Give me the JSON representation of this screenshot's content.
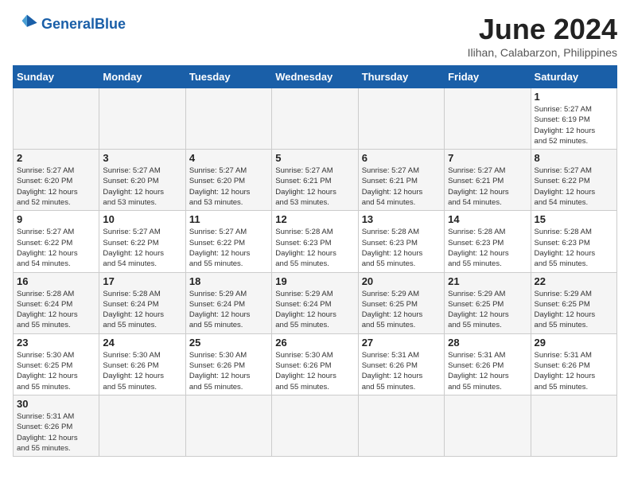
{
  "header": {
    "logo_general": "General",
    "logo_blue": "Blue",
    "month_title": "June 2024",
    "subtitle": "Ilihan, Calabarzon, Philippines"
  },
  "weekdays": [
    "Sunday",
    "Monday",
    "Tuesday",
    "Wednesday",
    "Thursday",
    "Friday",
    "Saturday"
  ],
  "weeks": [
    [
      {
        "day": "",
        "info": ""
      },
      {
        "day": "",
        "info": ""
      },
      {
        "day": "",
        "info": ""
      },
      {
        "day": "",
        "info": ""
      },
      {
        "day": "",
        "info": ""
      },
      {
        "day": "",
        "info": ""
      },
      {
        "day": "1",
        "info": "Sunrise: 5:27 AM\nSunset: 6:19 PM\nDaylight: 12 hours\nand 52 minutes."
      }
    ],
    [
      {
        "day": "2",
        "info": "Sunrise: 5:27 AM\nSunset: 6:20 PM\nDaylight: 12 hours\nand 52 minutes."
      },
      {
        "day": "3",
        "info": "Sunrise: 5:27 AM\nSunset: 6:20 PM\nDaylight: 12 hours\nand 53 minutes."
      },
      {
        "day": "4",
        "info": "Sunrise: 5:27 AM\nSunset: 6:20 PM\nDaylight: 12 hours\nand 53 minutes."
      },
      {
        "day": "5",
        "info": "Sunrise: 5:27 AM\nSunset: 6:21 PM\nDaylight: 12 hours\nand 53 minutes."
      },
      {
        "day": "6",
        "info": "Sunrise: 5:27 AM\nSunset: 6:21 PM\nDaylight: 12 hours\nand 54 minutes."
      },
      {
        "day": "7",
        "info": "Sunrise: 5:27 AM\nSunset: 6:21 PM\nDaylight: 12 hours\nand 54 minutes."
      },
      {
        "day": "8",
        "info": "Sunrise: 5:27 AM\nSunset: 6:22 PM\nDaylight: 12 hours\nand 54 minutes."
      }
    ],
    [
      {
        "day": "9",
        "info": "Sunrise: 5:27 AM\nSunset: 6:22 PM\nDaylight: 12 hours\nand 54 minutes."
      },
      {
        "day": "10",
        "info": "Sunrise: 5:27 AM\nSunset: 6:22 PM\nDaylight: 12 hours\nand 54 minutes."
      },
      {
        "day": "11",
        "info": "Sunrise: 5:27 AM\nSunset: 6:22 PM\nDaylight: 12 hours\nand 55 minutes."
      },
      {
        "day": "12",
        "info": "Sunrise: 5:28 AM\nSunset: 6:23 PM\nDaylight: 12 hours\nand 55 minutes."
      },
      {
        "day": "13",
        "info": "Sunrise: 5:28 AM\nSunset: 6:23 PM\nDaylight: 12 hours\nand 55 minutes."
      },
      {
        "day": "14",
        "info": "Sunrise: 5:28 AM\nSunset: 6:23 PM\nDaylight: 12 hours\nand 55 minutes."
      },
      {
        "day": "15",
        "info": "Sunrise: 5:28 AM\nSunset: 6:23 PM\nDaylight: 12 hours\nand 55 minutes."
      }
    ],
    [
      {
        "day": "16",
        "info": "Sunrise: 5:28 AM\nSunset: 6:24 PM\nDaylight: 12 hours\nand 55 minutes."
      },
      {
        "day": "17",
        "info": "Sunrise: 5:28 AM\nSunset: 6:24 PM\nDaylight: 12 hours\nand 55 minutes."
      },
      {
        "day": "18",
        "info": "Sunrise: 5:29 AM\nSunset: 6:24 PM\nDaylight: 12 hours\nand 55 minutes."
      },
      {
        "day": "19",
        "info": "Sunrise: 5:29 AM\nSunset: 6:24 PM\nDaylight: 12 hours\nand 55 minutes."
      },
      {
        "day": "20",
        "info": "Sunrise: 5:29 AM\nSunset: 6:25 PM\nDaylight: 12 hours\nand 55 minutes."
      },
      {
        "day": "21",
        "info": "Sunrise: 5:29 AM\nSunset: 6:25 PM\nDaylight: 12 hours\nand 55 minutes."
      },
      {
        "day": "22",
        "info": "Sunrise: 5:29 AM\nSunset: 6:25 PM\nDaylight: 12 hours\nand 55 minutes."
      }
    ],
    [
      {
        "day": "23",
        "info": "Sunrise: 5:30 AM\nSunset: 6:25 PM\nDaylight: 12 hours\nand 55 minutes."
      },
      {
        "day": "24",
        "info": "Sunrise: 5:30 AM\nSunset: 6:26 PM\nDaylight: 12 hours\nand 55 minutes."
      },
      {
        "day": "25",
        "info": "Sunrise: 5:30 AM\nSunset: 6:26 PM\nDaylight: 12 hours\nand 55 minutes."
      },
      {
        "day": "26",
        "info": "Sunrise: 5:30 AM\nSunset: 6:26 PM\nDaylight: 12 hours\nand 55 minutes."
      },
      {
        "day": "27",
        "info": "Sunrise: 5:31 AM\nSunset: 6:26 PM\nDaylight: 12 hours\nand 55 minutes."
      },
      {
        "day": "28",
        "info": "Sunrise: 5:31 AM\nSunset: 6:26 PM\nDaylight: 12 hours\nand 55 minutes."
      },
      {
        "day": "29",
        "info": "Sunrise: 5:31 AM\nSunset: 6:26 PM\nDaylight: 12 hours\nand 55 minutes."
      }
    ],
    [
      {
        "day": "30",
        "info": "Sunrise: 5:31 AM\nSunset: 6:26 PM\nDaylight: 12 hours\nand 55 minutes."
      },
      {
        "day": "",
        "info": ""
      },
      {
        "day": "",
        "info": ""
      },
      {
        "day": "",
        "info": ""
      },
      {
        "day": "",
        "info": ""
      },
      {
        "day": "",
        "info": ""
      },
      {
        "day": "",
        "info": ""
      }
    ]
  ]
}
